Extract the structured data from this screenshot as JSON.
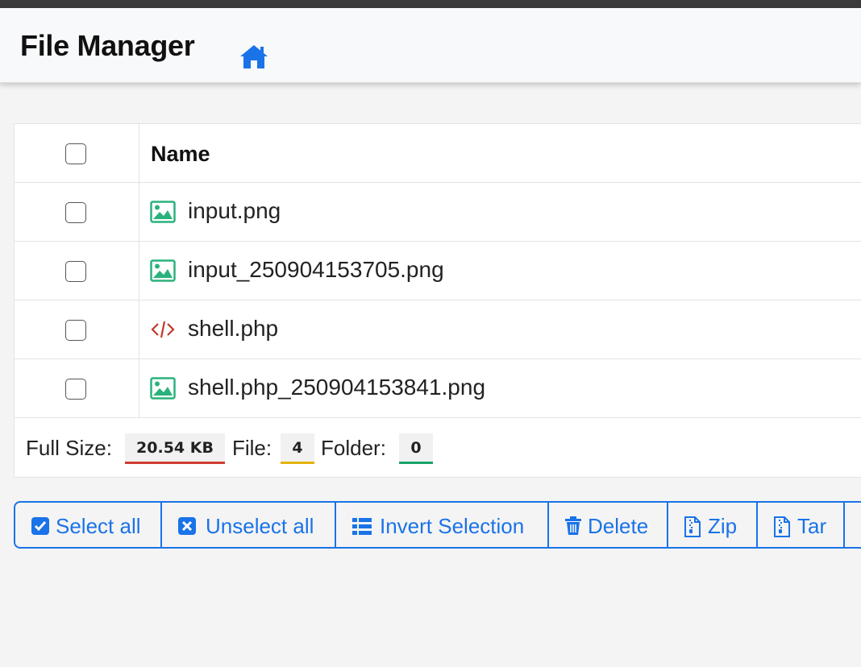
{
  "app": {
    "title": "File Manager"
  },
  "table": {
    "header": {
      "name": "Name"
    },
    "rows": [
      {
        "name": "input.png",
        "icon": "image-file-icon"
      },
      {
        "name": "input_250904153705.png",
        "icon": "image-file-icon"
      },
      {
        "name": "shell.php",
        "icon": "code-file-icon"
      },
      {
        "name": "shell.php_250904153841.png",
        "icon": "image-file-icon"
      }
    ],
    "footer": {
      "full_size_label": "Full Size:",
      "full_size_value": "20.54 KB",
      "file_label": "File:",
      "file_value": "4",
      "folder_label": "Folder:",
      "folder_value": "0"
    }
  },
  "actions": {
    "select_all": "Select all",
    "unselect_all": "Unselect all",
    "invert_selection": "Invert Selection",
    "delete": "Delete",
    "zip": "Zip",
    "tar": "Tar"
  },
  "colors": {
    "accent": "#1a73e8",
    "image_icon": "#2ab27b",
    "code_icon": "#c0392b",
    "size_badge": "#d13b2f",
    "file_badge": "#e5b30f",
    "folder_badge": "#16a36a"
  }
}
